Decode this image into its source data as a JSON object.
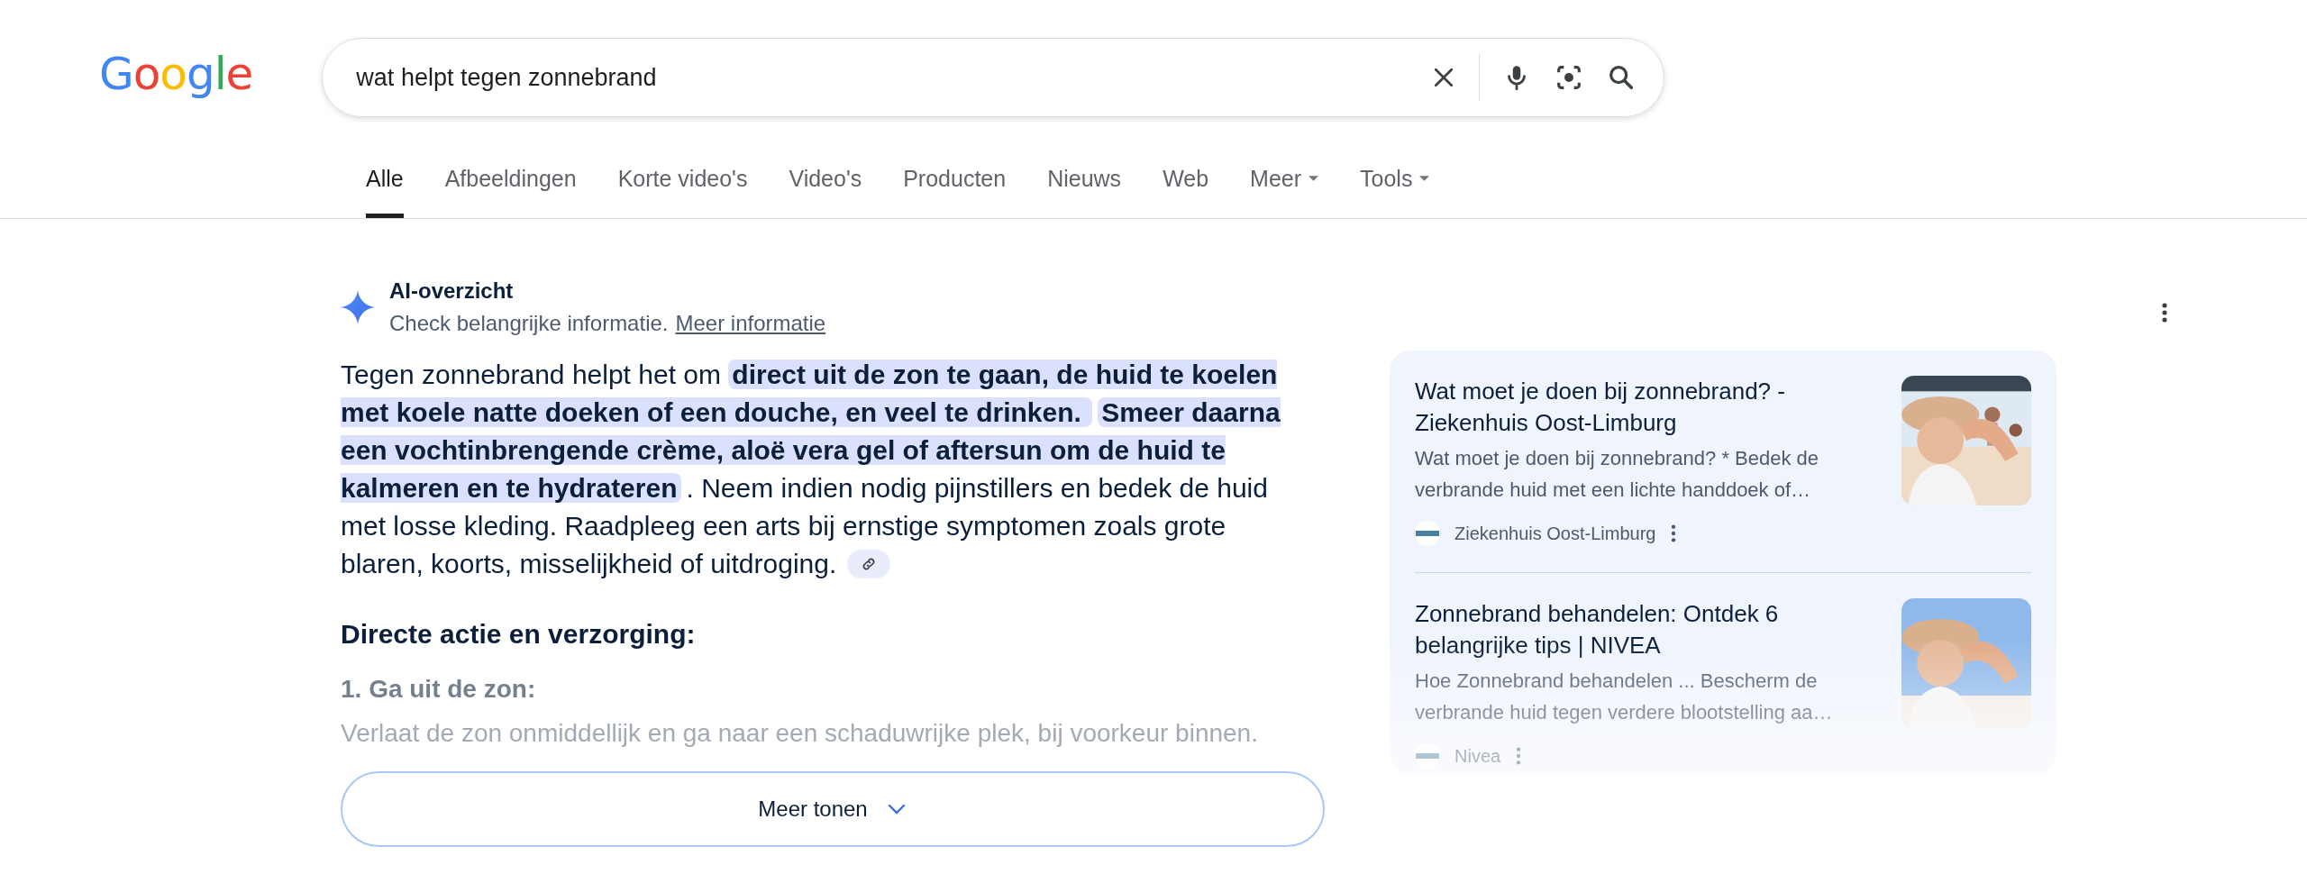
{
  "logo": "Google",
  "search": {
    "value": "wat helpt tegen zonnebrand"
  },
  "tabs": [
    {
      "label": "Alle",
      "selected": true,
      "kind": "plain"
    },
    {
      "label": "Afbeeldingen",
      "selected": false,
      "kind": "plain"
    },
    {
      "label": "Korte video's",
      "selected": false,
      "kind": "plain"
    },
    {
      "label": "Video's",
      "selected": false,
      "kind": "plain"
    },
    {
      "label": "Producten",
      "selected": false,
      "kind": "plain"
    },
    {
      "label": "Nieuws",
      "selected": false,
      "kind": "plain"
    },
    {
      "label": "Web",
      "selected": false,
      "kind": "plain"
    },
    {
      "label": "Meer",
      "selected": false,
      "kind": "menu"
    },
    {
      "label": "Tools",
      "selected": false,
      "kind": "menu"
    }
  ],
  "ai_overview": {
    "title": "AI-overzicht",
    "note": "Check belangrijke informatie.",
    "link": "Meer informatie",
    "answer": [
      {
        "text": "Tegen zonnebrand helpt het om ",
        "highlighted": false
      },
      {
        "text": "direct uit de zon te gaan, de huid te koelen met koele natte doeken of een douche, en veel te drinken. ",
        "highlighted": true
      },
      {
        "text": "Smeer daarna een vochtinbrengende crème, aloë vera gel of aftersun om de huid te kalmeren en te hydrateren",
        "highlighted": true
      },
      {
        "text": ". Neem indien nodig pijnstillers en bedek de huid met losse kleding. Raadpleeg een arts bij ernstige symptomen zoals grote blaren, koorts, misselijkheid of uitdroging.",
        "highlighted": false
      }
    ],
    "heading": "Directe actie en verzorging:",
    "step": "1. Ga uit de zon:",
    "step_text": "Verlaat de zon onmiddellijk en ga naar een schaduwrijke plek, bij voorkeur binnen.",
    "more_button": "Meer tonen"
  },
  "sources": [
    {
      "title": "Wat moet je doen bij zonnebrand? - Ziekenhuis Oost-Limburg",
      "snippet": "Wat moet je doen bij zonnebrand? * Bedek de verbrande huid met een lichte handdoek of…",
      "site": "Ziekenhuis Oost-Limburg"
    },
    {
      "title": "Zonnebrand behandelen: Ontdek 6 belangrijke tips | NIVEA",
      "snippet": "Hoe Zonnebrand behandelen ... Bescherm de verbrande huid tegen verdere blootstelling aa…",
      "site": "Nivea"
    }
  ]
}
